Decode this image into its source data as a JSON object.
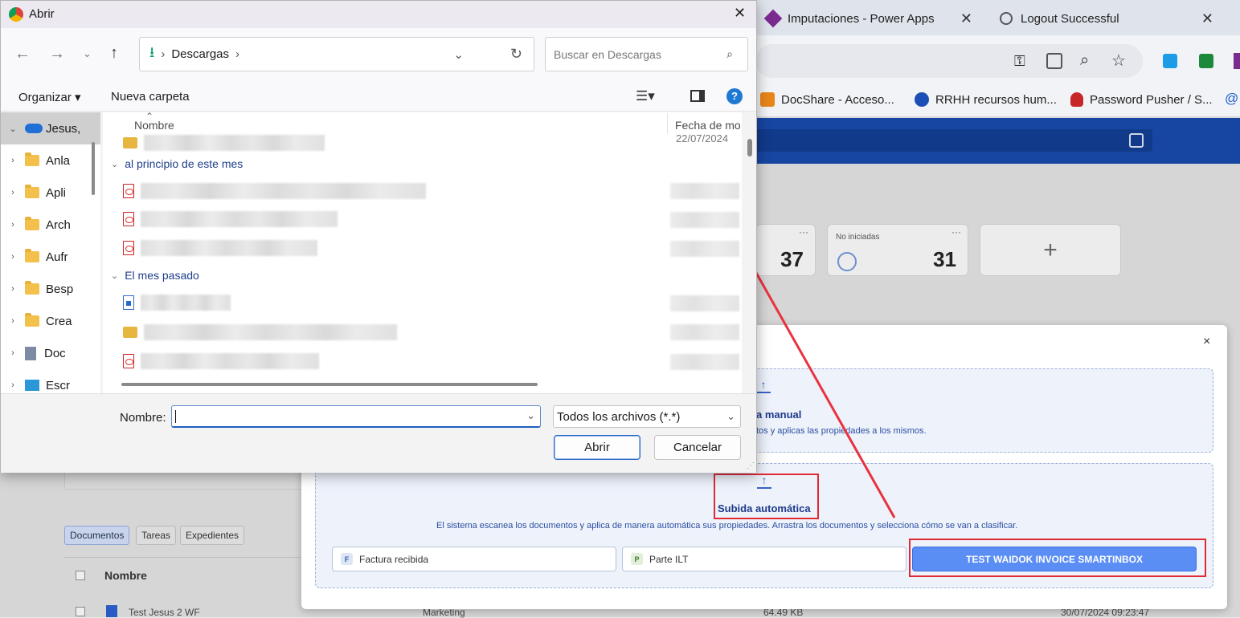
{
  "browser": {
    "tabs": [
      {
        "title": "Imputaciones - Power Apps"
      },
      {
        "title": "Logout Successful"
      }
    ],
    "bookmarks": [
      {
        "label": "DocShare - Acceso..."
      },
      {
        "label": "RRHH recursos hum..."
      },
      {
        "label": "Password Pusher / S..."
      }
    ]
  },
  "app": {
    "cards": [
      {
        "label": "",
        "value": "37"
      },
      {
        "label": "No iniciadas",
        "value": "31"
      }
    ],
    "add_symbol": "+",
    "lower_tabs": [
      "Documentos",
      "Tareas",
      "Expedientes"
    ],
    "table": {
      "header_name": "Nombre",
      "row": {
        "name": "Test Jesus 2 WF",
        "dept": "Marketing",
        "size": "64.49 KB",
        "date": "30/07/2024 09:23:47"
      }
    }
  },
  "modal": {
    "close": "×",
    "manual": {
      "title": "a manual",
      "desc": "tos y aplicas las propiedades a los mismos."
    },
    "auto": {
      "title": "Subida automática",
      "desc": "El sistema escanea los documentos y aplica de manera automática sus propiedades. Arrastra los documentos y selecciona cómo se van a clasificar."
    },
    "options": [
      {
        "tag": "F",
        "label": "Factura recibida"
      },
      {
        "tag": "P",
        "label": "Parte ILT"
      },
      {
        "tag": "",
        "label": "TEST WAIDOK INVOICE SMARTINBOX"
      }
    ]
  },
  "dialog": {
    "title": "Abrir",
    "close": "✕",
    "location": "Descargas",
    "search_placeholder": "Buscar en Descargas",
    "organize": "Organizar",
    "new_folder": "Nueva carpeta",
    "help": "?",
    "nav": [
      {
        "label": "Jesus,"
      },
      {
        "label": "Anla"
      },
      {
        "label": "Apli"
      },
      {
        "label": "Arch"
      },
      {
        "label": "Aufr"
      },
      {
        "label": "Besp"
      },
      {
        "label": "Crea"
      },
      {
        "label": "Doc"
      },
      {
        "label": "Escr"
      }
    ],
    "columns": {
      "name": "Nombre",
      "date": "Fecha de mo"
    },
    "first_date": "22/07/2024",
    "groups": [
      {
        "label": "al principio de este mes"
      },
      {
        "label": "El mes pasado"
      }
    ],
    "filename_label": "Nombre:",
    "filename_value": "",
    "filetype": "Todos los archivos (*.*)",
    "open": "Abrir",
    "cancel": "Cancelar"
  },
  "colors": {
    "accent": "#1746a2",
    "annotation": "#e02935",
    "primary_option": "#5b8ef5"
  }
}
